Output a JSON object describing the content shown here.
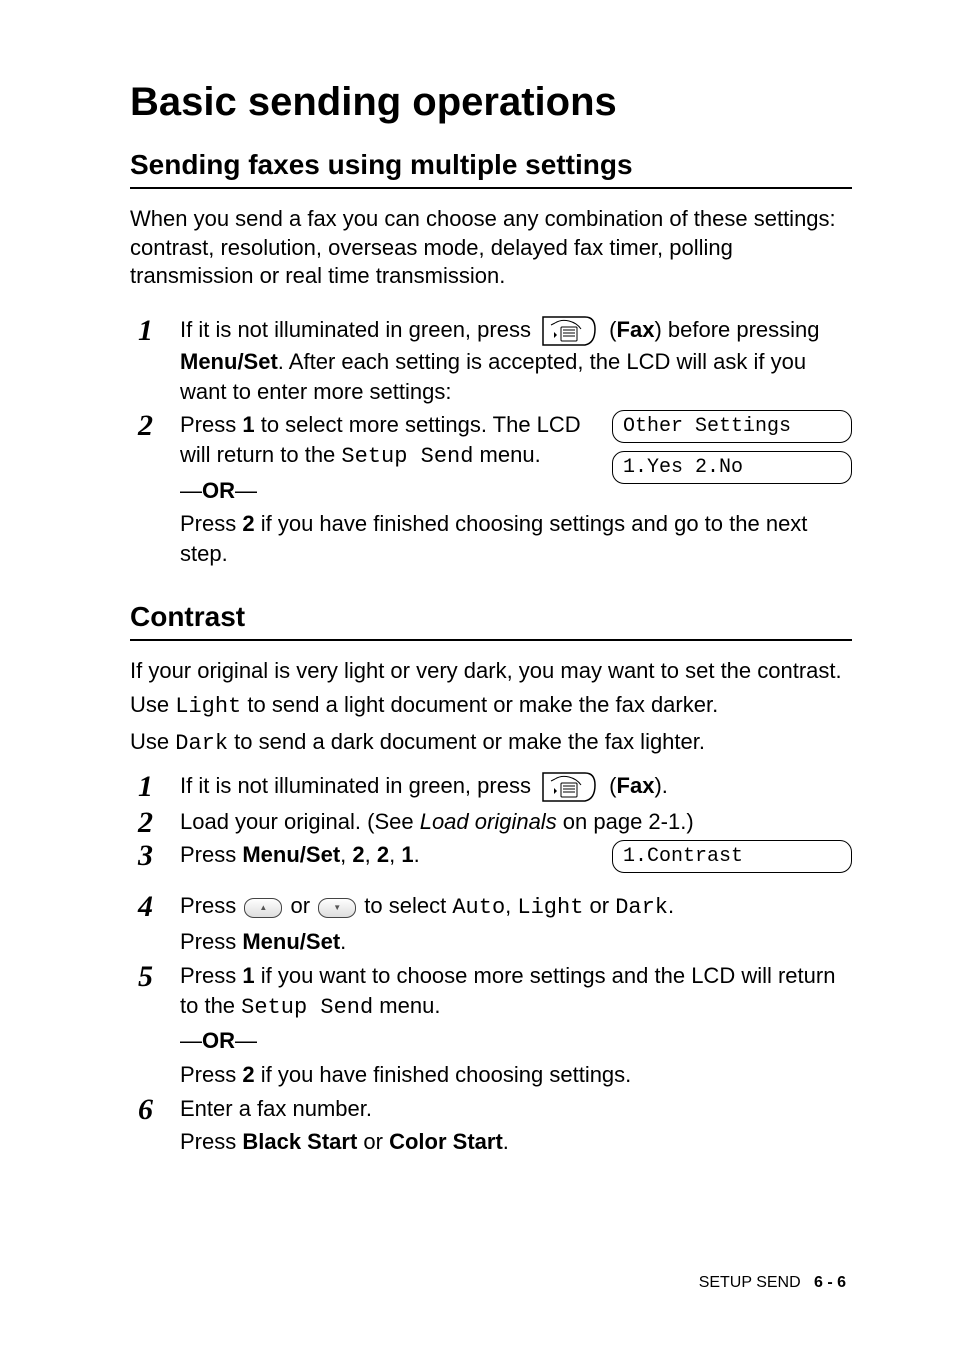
{
  "headings": {
    "h1": "Basic sending operations",
    "h2a": "Sending faxes using multiple settings",
    "h2b": "Contrast"
  },
  "intro": "When you send a fax you can choose any combination of these settings: contrast, resolution, overseas mode, delayed fax timer, polling transmission or real time transmission.",
  "section1": {
    "step1": {
      "pre": "If it is not illuminated in green, press ",
      "faxLabel": "Fax",
      "post1": ") before pressing ",
      "menuSet": "Menu/Set",
      "post2": ". After each setting is accepted, the LCD will ask if you want to enter more settings:"
    },
    "step2": {
      "line1a": "Press ",
      "one": "1",
      "line1b": " to select more settings. The LCD will return to the ",
      "setupSend": "Setup Send",
      "line1c": " menu.",
      "or": "OR",
      "line2a": "Press ",
      "two": "2",
      "line2b": " if you have finished choosing settings and go to the next step."
    },
    "lcd1": "Other Settings",
    "lcd2": "1.Yes 2.No"
  },
  "contrast": {
    "para1": "If your original is very light or very dark, you may want to set the contrast.",
    "para2a": "Use ",
    "light": "Light",
    "para2b": " to send a light document or make the fax darker.",
    "para3a": "Use ",
    "dark": "Dark",
    "para3b": " to send a dark document or make the fax lighter.",
    "step1": {
      "pre": "If it is not illuminated in green, press ",
      "faxLabel": "Fax",
      "post": ")."
    },
    "step2": {
      "a": "Load your original. (See ",
      "link": "Load originals",
      "b": " on page 2-1.)"
    },
    "step3": {
      "a": "Press ",
      "menuSet": "Menu/Set",
      "b": ", ",
      "n1": "2",
      "n2": "2",
      "n3": "1",
      "end": "."
    },
    "lcd": "1.Contrast",
    "step4": {
      "a": "Press ",
      "orWord": " or ",
      "b": " to select ",
      "auto": "Auto",
      "c": ", ",
      "light": "Light",
      "orWord2": " or ",
      "dark": "Dark",
      "d": ".",
      "press": "Press ",
      "menuSet": "Menu/Set",
      "e": "."
    },
    "step5": {
      "a": "Press ",
      "one": "1",
      "b": " if you want to choose more settings and the LCD will return to the ",
      "setupSend": "Setup Send",
      "c": " menu.",
      "or": "OR",
      "d": "Press ",
      "two": "2",
      "e": " if you have finished choosing settings."
    },
    "step6": {
      "a": "Enter a fax number.",
      "b": "Press ",
      "black": "Black Start",
      "orWord": " or ",
      "color": "Color Start",
      "c": "."
    }
  },
  "footer": {
    "label": "SETUP SEND",
    "page": "6 - 6"
  }
}
